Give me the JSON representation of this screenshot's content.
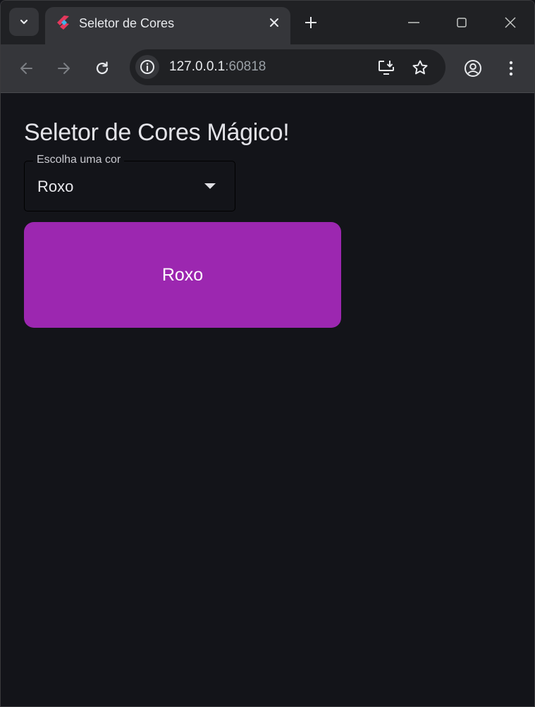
{
  "browser": {
    "tab": {
      "title": "Seletor de Cores"
    },
    "address": {
      "host": "127.0.0.1",
      "port": ":60818"
    },
    "icons": {
      "tab_menu": "chevron-down-icon",
      "tab_close": "close-icon",
      "new_tab": "plus-icon",
      "minimize": "minimize-icon",
      "maximize": "maximize-icon",
      "close_window": "close-icon",
      "back": "arrow-left-icon",
      "forward": "arrow-right-icon",
      "reload": "reload-icon",
      "site_info": "info-icon",
      "install_app": "install-icon",
      "bookmark": "star-icon",
      "profile": "profile-icon",
      "menu": "more-vert-icon"
    }
  },
  "app": {
    "title": "Seletor de Cores Mágico!",
    "select": {
      "label": "Escolha uma cor",
      "value": "Roxo"
    },
    "color_button": {
      "label": "Roxo",
      "color": "#9c27b0"
    }
  },
  "theme": {
    "page_background": "#131419",
    "tabstrip_background": "#202124",
    "toolbar_background": "#35363a"
  }
}
